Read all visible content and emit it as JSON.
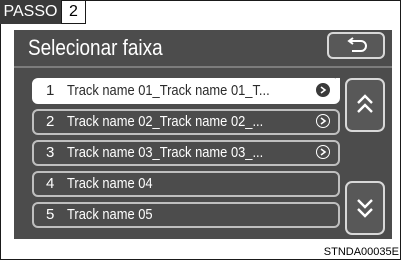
{
  "step": {
    "label": "PASSO",
    "number": "2"
  },
  "screen": {
    "title": "Selecionar faixa",
    "back_icon": "back-arrow-icon"
  },
  "tracks": [
    {
      "number": "1",
      "name": "Track name 01_Track name 01_T...",
      "icon": "disc-arrow-icon",
      "selected": true
    },
    {
      "number": "2",
      "name": "Track name 02_Track name 02_...",
      "icon": "disc-arrow-icon",
      "selected": false
    },
    {
      "number": "3",
      "name": "Track name 03_Track name 03_...",
      "icon": "disc-arrow-icon",
      "selected": false
    },
    {
      "number": "4",
      "name": "Track name 04",
      "selected": false
    },
    {
      "number": "5",
      "name": "Track name 05",
      "selected": false
    }
  ],
  "scroll": {
    "up_icon": "double-chevron-up-icon",
    "down_icon": "double-chevron-down-icon"
  },
  "caption": "STNDA00035E",
  "colors": {
    "screen_bg": "#4c4c4c",
    "border": "#bfbfbf",
    "selected_bg": "#ffffff",
    "text": "#ffffff"
  }
}
